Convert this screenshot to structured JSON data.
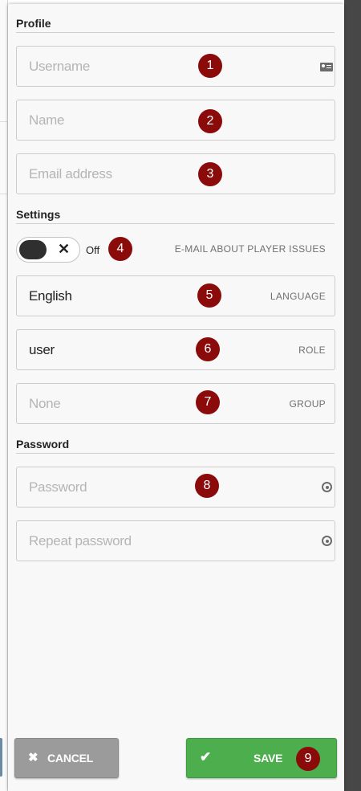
{
  "profile": {
    "title": "Profile",
    "username_placeholder": "Username",
    "name_placeholder": "Name",
    "email_placeholder": "Email address"
  },
  "settings": {
    "title": "Settings",
    "toggle_state": "Off",
    "toggle_caption": "E-MAIL ABOUT PLAYER ISSUES",
    "language_value": "English",
    "language_label": "LANGUAGE",
    "role_value": "user",
    "role_label": "ROLE",
    "group_value": "None",
    "group_label": "GROUP"
  },
  "password": {
    "title": "Password",
    "password_placeholder": "Password",
    "repeat_placeholder": "Repeat password"
  },
  "buttons": {
    "cancel": "CANCEL",
    "save": "SAVE"
  },
  "badges": [
    "1",
    "2",
    "3",
    "4",
    "5",
    "6",
    "7",
    "8",
    "9"
  ],
  "icons": {
    "username": "contact-card-icon",
    "password": "key-icon",
    "repeat_password": "key-icon",
    "cancel": "close-icon",
    "save": "checkmark-icon",
    "toggle": "close-icon"
  },
  "colors": {
    "badge": "#8b0b0b",
    "save": "#4cae4c",
    "cancel": "#9b9b9b"
  }
}
